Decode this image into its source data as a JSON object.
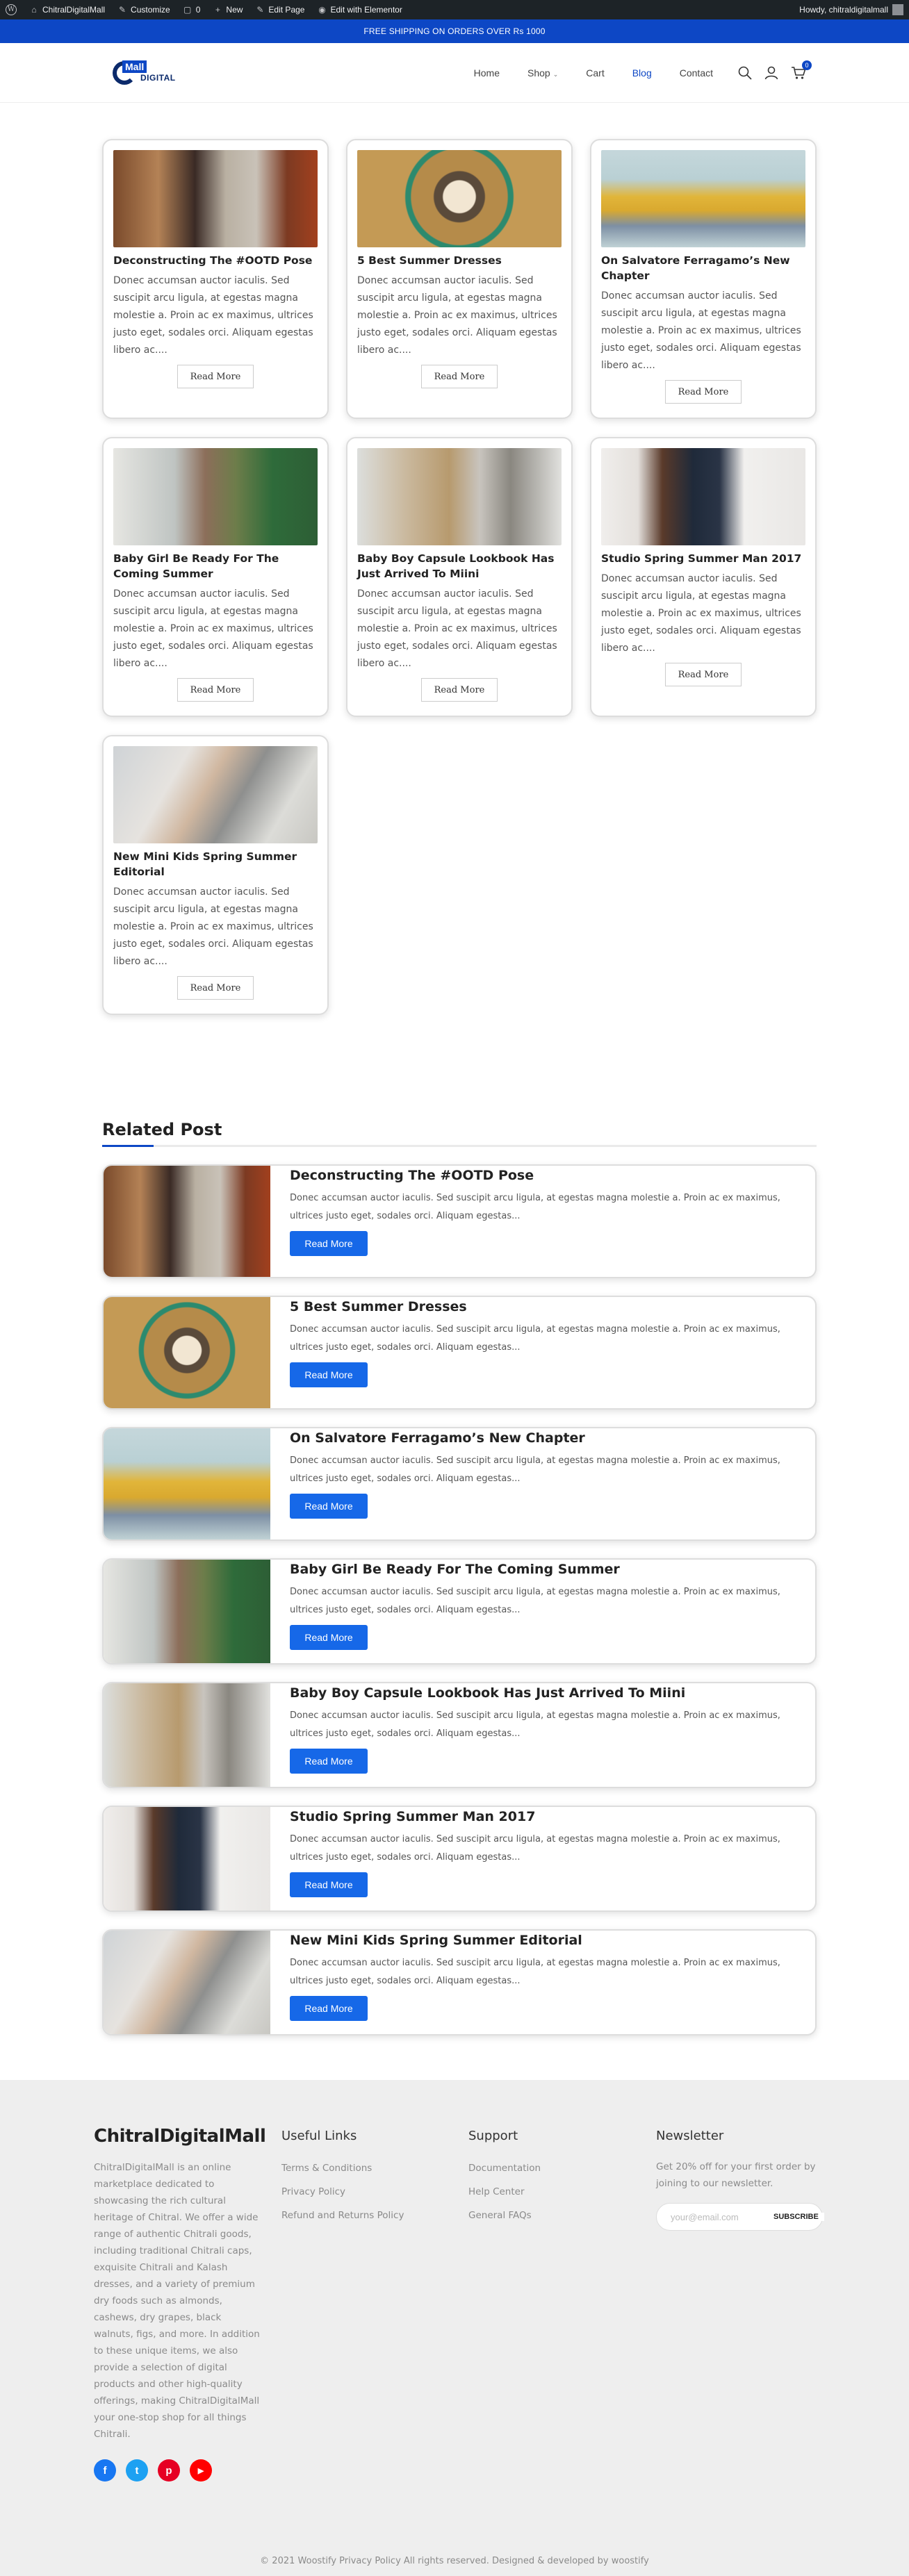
{
  "admin_bar": {
    "site": "ChitralDigitalMall",
    "customize": "Customize",
    "comments_count": "0",
    "new": "New",
    "edit_page": "Edit Page",
    "edit_elementor": "Edit with Elementor",
    "howdy": "Howdy, chitraldigitalmall"
  },
  "promo": {
    "text": "FREE SHIPPING ON ORDERS OVER Rs 1000"
  },
  "header": {
    "logo_top": "Mall",
    "logo_bottom": "DIGITAL",
    "nav": [
      "Home",
      "Shop",
      "Cart",
      "Blog",
      "Contact"
    ],
    "cart_count": "0"
  },
  "posts": [
    {
      "title": "Deconstructing The #OOTD Pose",
      "excerpt": "Donec accumsan auctor iaculis. Sed suscipit arcu ligula, at egestas magna molestie a. Proin ac ex maximus, ultrices justo eget, sodales orci. Aliquam egestas libero ac....",
      "button": "Read More",
      "image": "ootd-two-women-photo"
    },
    {
      "title": "5 Best Summer Dresses",
      "excerpt": "Donec accumsan auctor iaculis. Sed suscipit arcu ligula, at egestas magna molestie a. Proin ac ex maximus, ultrices justo eget, sodales orci. Aliquam egestas libero ac....",
      "button": "Read More",
      "image": "woman-wheel-photo"
    },
    {
      "title": "On Salvatore Ferragamo’s New Chapter",
      "excerpt": "Donec accumsan auctor iaculis. Sed suscipit arcu ligula, at egestas magna molestie a. Proin ac ex maximus, ultrices justo eget, sodales orci. Aliquam egestas libero ac....",
      "button": "Read More",
      "image": "woman-yellow-shirt-photo"
    },
    {
      "title": "Baby Girl Be Ready For The Coming Summer",
      "excerpt": "Donec accumsan auctor iaculis. Sed suscipit arcu ligula, at egestas magna molestie a. Proin ac ex maximus, ultrices justo eget, sodales orci. Aliquam egestas libero ac....",
      "button": "Read More",
      "image": "baby-girl-photo"
    },
    {
      "title": "Baby Boy Capsule Lookbook Has Just Arrived To Miini",
      "excerpt": "Donec accumsan auctor iaculis. Sed suscipit arcu ligula, at egestas magna molestie a. Proin ac ex maximus, ultrices justo eget, sodales orci. Aliquam egestas libero ac....",
      "button": "Read More",
      "image": "baby-boys-crib-photo"
    },
    {
      "title": "Studio Spring Summer Man 2017",
      "excerpt": "Donec accumsan auctor iaculis. Sed suscipit arcu ligula, at egestas magna molestie a. Proin ac ex maximus, ultrices justo eget, sodales orci. Aliquam egestas libero ac....",
      "button": "Read More",
      "image": "man-studio-photo"
    },
    {
      "title": "New Mini Kids Spring Summer Editorial",
      "excerpt": "Donec accumsan auctor iaculis. Sed suscipit arcu ligula, at egestas magna molestie a. Proin ac ex maximus, ultrices justo eget, sodales orci. Aliquam egestas libero ac....",
      "button": "Read More",
      "image": "baby-sitting-photo"
    }
  ],
  "related": {
    "heading": "Related Post",
    "items": [
      {
        "title": "Deconstructing The #OOTD Pose",
        "excerpt": "Donec accumsan auctor iaculis. Sed suscipit arcu ligula, at egestas magna molestie a. Proin ac ex maximus, ultrices justo eget, sodales orci. Aliquam egestas...",
        "button": "Read More"
      },
      {
        "title": "5 Best Summer Dresses",
        "excerpt": "Donec accumsan auctor iaculis. Sed suscipit arcu ligula, at egestas magna molestie a. Proin ac ex maximus, ultrices justo eget, sodales orci. Aliquam egestas...",
        "button": "Read More"
      },
      {
        "title": "On Salvatore Ferragamo’s New Chapter",
        "excerpt": "Donec accumsan auctor iaculis. Sed suscipit arcu ligula, at egestas magna molestie a. Proin ac ex maximus, ultrices justo eget, sodales orci. Aliquam egestas...",
        "button": "Read More"
      },
      {
        "title": "Baby Girl Be Ready For The Coming Summer",
        "excerpt": "Donec accumsan auctor iaculis. Sed suscipit arcu ligula, at egestas magna molestie a. Proin ac ex maximus, ultrices justo eget, sodales orci. Aliquam egestas...",
        "button": "Read More"
      },
      {
        "title": "Baby Boy Capsule Lookbook Has Just Arrived To Miini",
        "excerpt": "Donec accumsan auctor iaculis. Sed suscipit arcu ligula, at egestas magna molestie a. Proin ac ex maximus, ultrices justo eget, sodales orci. Aliquam egestas...",
        "button": "Read More"
      },
      {
        "title": "Studio Spring Summer Man 2017",
        "excerpt": "Donec accumsan auctor iaculis. Sed suscipit arcu ligula, at egestas magna molestie a. Proin ac ex maximus, ultrices justo eget, sodales orci. Aliquam egestas...",
        "button": "Read More"
      },
      {
        "title": "New Mini Kids Spring Summer Editorial",
        "excerpt": "Donec accumsan auctor iaculis. Sed suscipit arcu ligula, at egestas magna molestie a. Proin ac ex maximus, ultrices justo eget, sodales orci. Aliquam egestas...",
        "button": "Read More"
      }
    ]
  },
  "footer": {
    "brand": "ChitralDigitalMall",
    "about": "ChitralDigitalMall is an online marketplace dedicated to showcasing the rich cultural heritage of Chitral. We offer a wide range of authentic Chitrali goods, including traditional Chitrali caps, exquisite Chitrali and Kalash dresses, and a variety of premium dry foods such as almonds, cashews, dry grapes, black walnuts, figs, and more. In addition to these unique items, we also provide a selection of digital products and other high-quality offerings, making ChitralDigitalMall your one-stop shop for all things Chitrali.",
    "useful_links": {
      "heading": "Useful Links",
      "items": [
        "Terms & Conditions",
        "Privacy Policy",
        "Refund and Returns Policy"
      ]
    },
    "support": {
      "heading": "Support",
      "items": [
        "Documentation",
        "Help Center",
        "General FAQs"
      ]
    },
    "newsletter": {
      "heading": "Newsletter",
      "text": "Get 20% off for your first order by joining to our newsletter.",
      "placeholder": "your@email.com",
      "button": "SUBSCRIBE"
    },
    "social": [
      {
        "name": "facebook-icon",
        "glyph": "f",
        "color": "#1877f2"
      },
      {
        "name": "twitter-icon",
        "glyph": "t",
        "color": "#1da1f2"
      },
      {
        "name": "pinterest-icon",
        "glyph": "p",
        "color": "#e60023"
      },
      {
        "name": "youtube-icon",
        "glyph": "▶",
        "color": "#ff0000"
      }
    ],
    "copyright": "© 2021 Woostify Privacy Policy All rights reserved. Designed & developed by woostify"
  },
  "colors": {
    "accent": "#0d47c5",
    "button_blue": "#1668e8",
    "admin_bar": "#1d2327"
  }
}
